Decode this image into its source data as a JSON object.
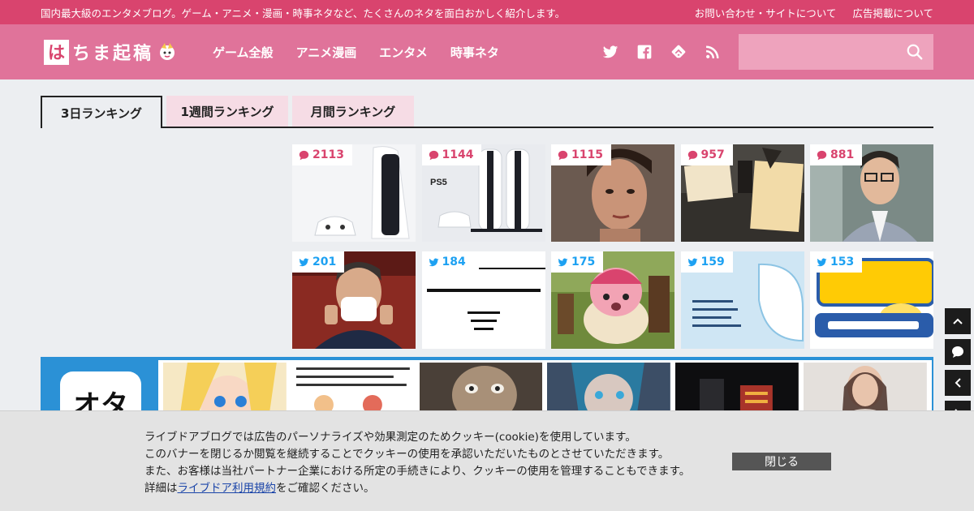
{
  "topbar": {
    "tagline": "国内最大級のエンタメブログ。ゲーム・アニメ・漫画・時事ネタなど、たくさんのネタを面白おかしく紹介します。",
    "links": [
      "お問い合わせ・サイトについて",
      "広告掲載について"
    ]
  },
  "header": {
    "logo_mark": "は",
    "logo_text": "ちま起稿",
    "nav": [
      "ゲーム全般",
      "アニメ漫画",
      "エンタメ",
      "時事ネタ"
    ],
    "search_placeholder": ""
  },
  "tabs": [
    {
      "label": "3日ランキング",
      "active": true
    },
    {
      "label": "1週間ランキング",
      "active": false
    },
    {
      "label": "月間ランキング",
      "active": false
    }
  ],
  "ranking": {
    "comments": [
      {
        "count": "2113",
        "icon": "comment-icon"
      },
      {
        "count": "1144",
        "icon": "comment-icon"
      },
      {
        "count": "1115",
        "icon": "comment-icon"
      },
      {
        "count": "957",
        "icon": "comment-icon"
      },
      {
        "count": "881",
        "icon": "comment-icon"
      }
    ],
    "tweets": [
      {
        "count": "201",
        "icon": "twitter-icon"
      },
      {
        "count": "184",
        "icon": "twitter-icon"
      },
      {
        "count": "175",
        "icon": "twitter-icon"
      },
      {
        "count": "159",
        "icon": "twitter-icon"
      },
      {
        "count": "153",
        "icon": "twitter-icon"
      }
    ]
  },
  "promo": {
    "app_text": "オタ"
  },
  "cookie": {
    "line1": "ライブドアブログでは広告のパーソナライズや効果測定のためクッキー(cookie)を使用しています。",
    "line2": "このバナーを閉じるか閲覧を継続することでクッキーの使用を承認いただいたものとさせていただきます。",
    "line3": "また、お客様は当社パートナー企業における所定の手続きにより、クッキーの使用を管理することもできます。",
    "line4_prefix": "詳細は",
    "line4_link": "ライブドア利用規約",
    "line4_suffix": "をご確認ください。",
    "close_label": "閉じる"
  },
  "colors": {
    "topbar": "#d9446e",
    "header": "#e0739a",
    "comment_accent": "#d9446e",
    "twitter_accent": "#1da1f2",
    "promo_blue": "#2b91d6"
  }
}
